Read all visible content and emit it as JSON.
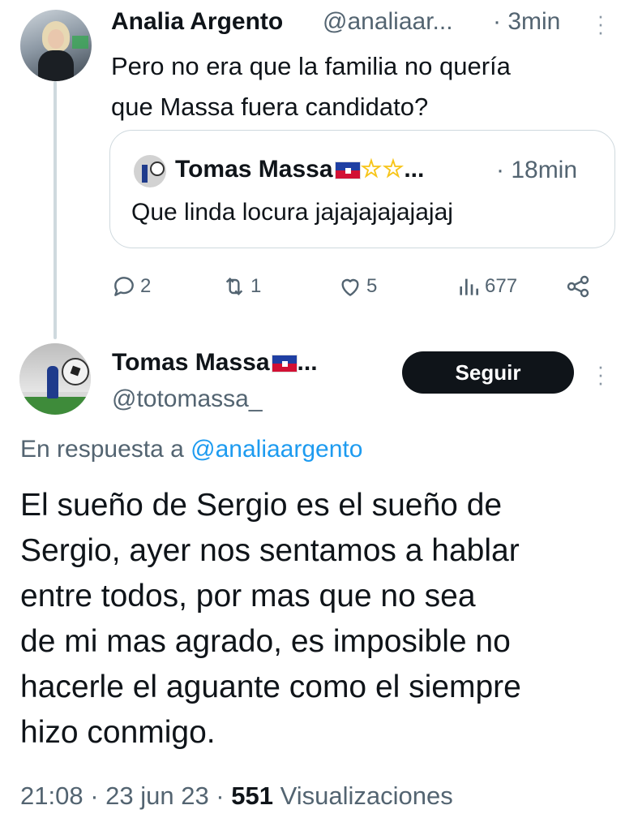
{
  "tweet": {
    "author_name": "Analia Argento",
    "handle": "@analiaar...",
    "time": "· 3min",
    "text_line1": "Pero no era que la familia no quería",
    "text_line2": "que Massa fuera candidato?",
    "quote": {
      "author_name": "Tomas Massa",
      "ellipsis": "...",
      "time": "· 18min",
      "text": "Que linda locura jajajajajajajaj"
    },
    "actions": {
      "replies": "2",
      "retweets": "1",
      "likes": "5",
      "views": "677"
    }
  },
  "reply": {
    "author_name": "Tomas Massa",
    "ellipsis": "...",
    "handle": "@totomassa_",
    "follow_label": "Seguir",
    "reply_prefix": "En respuesta a",
    "reply_to": "@analiaargento",
    "text_lines": [
      "El sueño de Sergio es el sueño de",
      "Sergio, ayer nos sentamos a hablar",
      "entre todos, por mas que no sea",
      "de mi mas agrado, es imposible no",
      "hacerle el aguante como el siempre",
      "hizo conmigo."
    ],
    "time": "21:08",
    "date": "· 23 jun 23 ·",
    "views_count": "551",
    "views_label": "Visualizaciones"
  },
  "icons": [
    "reply-icon",
    "retweet-icon",
    "like-icon",
    "views-icon",
    "share-icon",
    "more-icon"
  ]
}
